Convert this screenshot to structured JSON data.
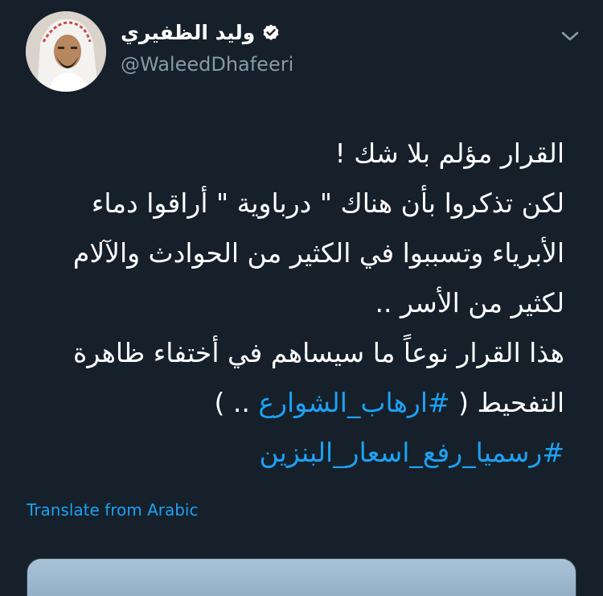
{
  "author": {
    "display_name": "وليد الظفيري",
    "handle": "@WaleedDhafeeri",
    "verified": true,
    "verified_icon": "verified-badge-icon"
  },
  "tweet": {
    "lines": [
      "القرار مؤلم بلا شك !",
      "لكن تذكروا  بأن هناك \" درباوية \" أراقوا دماء",
      "الأبرياء وتسببوا في الكثير من الحوادث والآلام",
      "لكثير من الأسر ..",
      "هذا القرار نوعاً ما سيساهم في أختفاء ظاهرة"
    ],
    "line6_text": "التفحيط ( ",
    "line6_hashtag": "#ارهاب_الشوارع",
    "line6_tail": " .. )",
    "hashtag2": "#رسميا_رفع_اسعار_البنزين"
  },
  "translate_label": "Translate from Arabic",
  "colors": {
    "background": "#15202b",
    "link": "#1da1f2",
    "secondary_text": "#8899a6"
  }
}
